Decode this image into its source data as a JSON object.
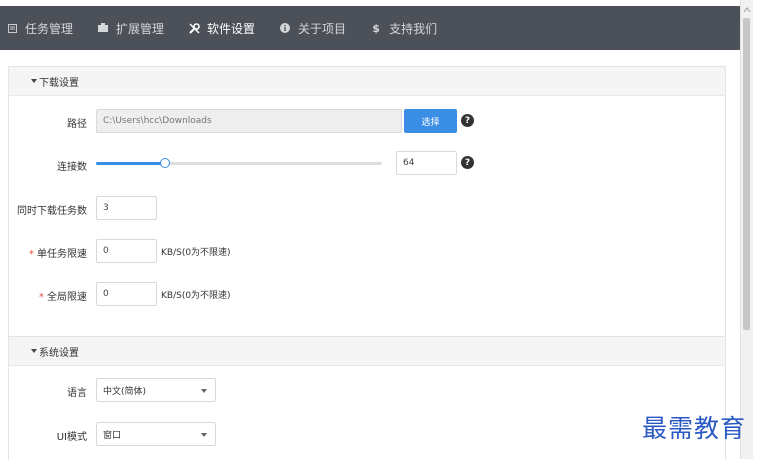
{
  "nav": {
    "items": [
      {
        "label": "任务管理",
        "icon": "list-icon"
      },
      {
        "label": "扩展管理",
        "icon": "puzzle-icon"
      },
      {
        "label": "软件设置",
        "icon": "wrench-icon"
      },
      {
        "label": "关于项目",
        "icon": "info-circle-icon"
      },
      {
        "label": "支持我们",
        "icon": "dollar-icon"
      }
    ],
    "active_index": 2
  },
  "download_section": {
    "title": "下载设置",
    "path": {
      "label": "路径",
      "placeholder": "C:\\Users\\hcc\\Downloads",
      "button": "选择",
      "help": "?"
    },
    "connections": {
      "label": "连接数",
      "value": "64",
      "slider_fraction": 0.24,
      "help": "?"
    },
    "concurrent": {
      "label": "同时下载任务数",
      "value": "3"
    },
    "task_limit": {
      "required": "*",
      "label": "单任务限速",
      "value": "0",
      "unit": "KB/S(0为不限速)"
    },
    "global_limit": {
      "required": "*",
      "label": "全局限速",
      "value": "0",
      "unit": "KB/S(0为不限速)"
    }
  },
  "system_section": {
    "title": "系统设置",
    "language": {
      "label": "语言",
      "value": "中文(简体)"
    },
    "ui_mode": {
      "label": "UI模式",
      "value": "窗口"
    }
  },
  "watermark": "最需教育",
  "colors": {
    "nav_bg": "#4c5058",
    "accent": "#3a8ee6",
    "required": "#e74c3c"
  }
}
